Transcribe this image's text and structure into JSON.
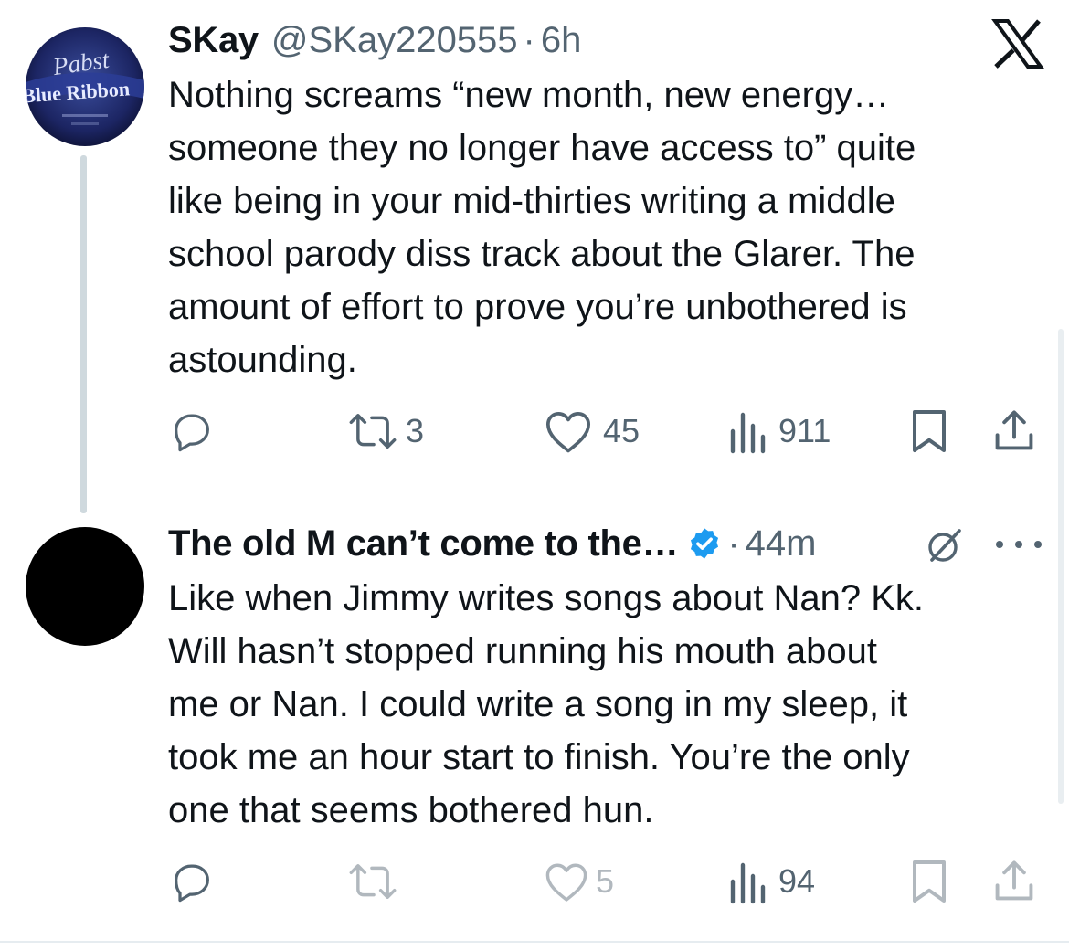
{
  "tweets": [
    {
      "display_name": "SKay",
      "handle": "@SKay220555",
      "separator": "·",
      "time": "6h",
      "text": "Nothing screams “new month, new energy…\nsomeone they no longer have access to” quite\nlike being in your mid-thirties writing a middle\nschool parody diss track about the Glarer. The\namount of effort to prove you’re unbothered is\nastounding.",
      "avatar_text": [
        "Pabst",
        "Blue Ribbon"
      ],
      "stats": {
        "replies": "",
        "reposts": "3",
        "likes": "45",
        "views": "911"
      }
    },
    {
      "display_name": "The old M can’t come to the…",
      "verified": true,
      "separator": "·",
      "time": "44m",
      "text": "Like when Jimmy writes songs about Nan? Kk.\nWill hasn’t stopped running his mouth about\nme or Nan. I could write a song in my sleep, it\ntook me an hour start to finish. You’re the only\none that seems bothered hun.",
      "stats": {
        "replies": "",
        "reposts": "",
        "likes": "5",
        "views": "94"
      }
    }
  ],
  "icons": {
    "close": "x-close-icon",
    "reply": "reply-icon",
    "repost": "repost-icon",
    "like": "heart-icon",
    "views": "views-icon",
    "bookmark": "bookmark-icon",
    "share": "share-icon",
    "verified": "verified-badge-icon",
    "grok": "grok-icon",
    "more": "more-icon"
  },
  "colors": {
    "text": "#0f1419",
    "muted": "#536471",
    "verified": "#1d9bf0",
    "thread_line": "#cfd9de"
  }
}
